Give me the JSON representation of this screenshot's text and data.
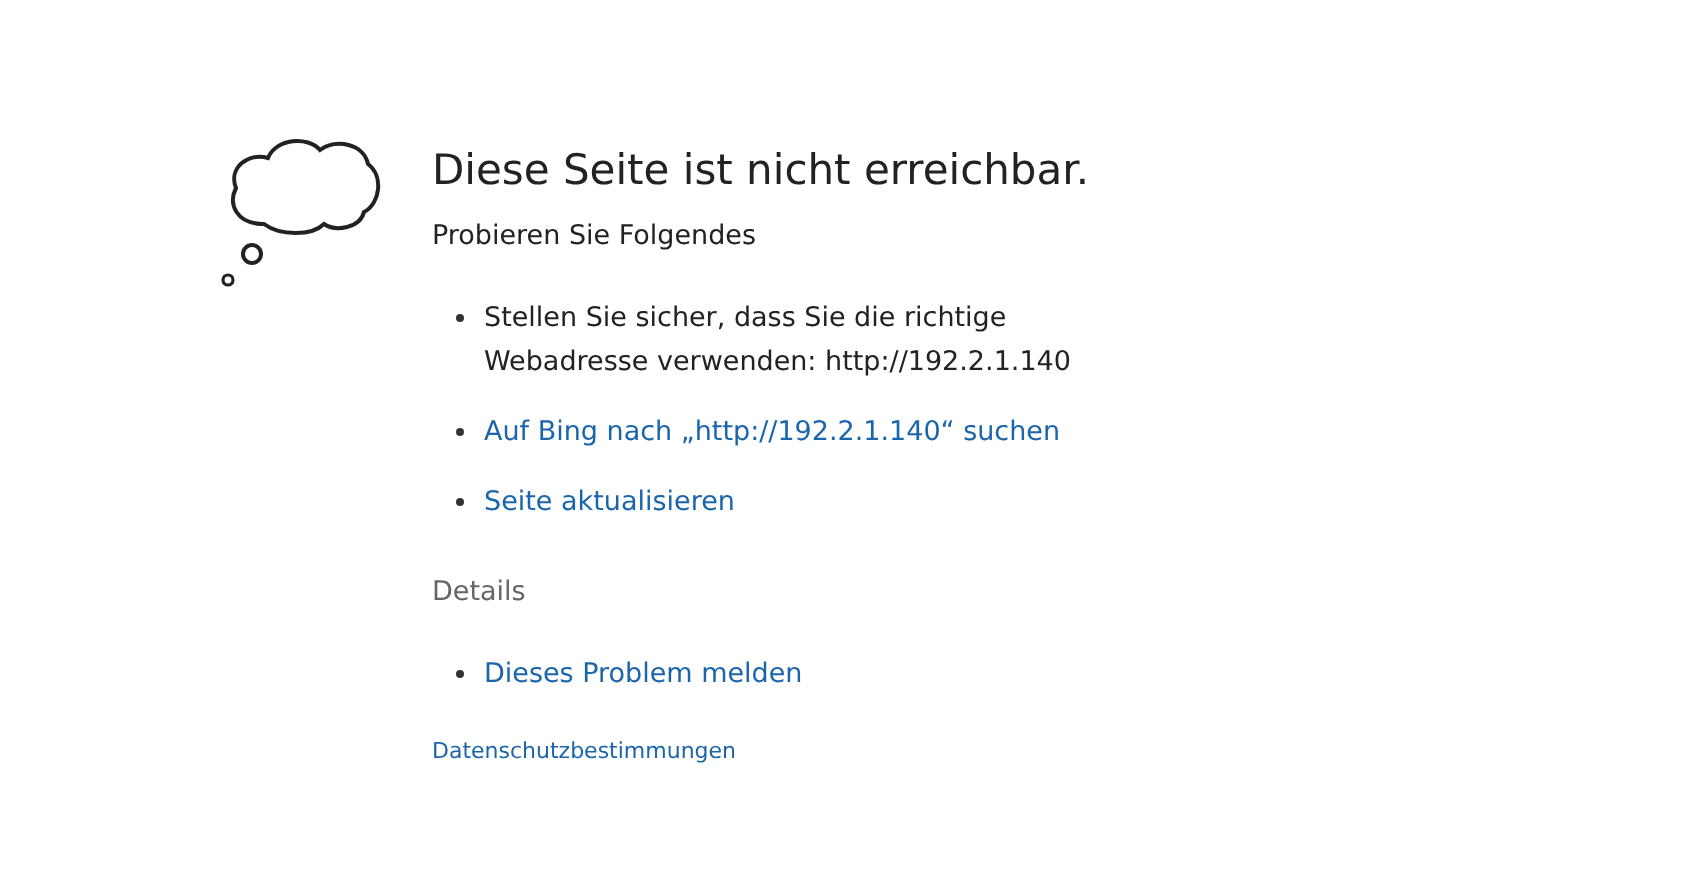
{
  "title": "Diese Seite ist nicht erreichbar.",
  "subtitle": "Probieren Sie Folgendes",
  "suggestions": [
    {
      "kind": "text",
      "text": "Stellen Sie sicher, dass Sie die richtige Webadresse verwenden: http://192.2.1.140"
    },
    {
      "kind": "link",
      "text": "Auf Bing nach „http://192.2.1.140“ suchen"
    },
    {
      "kind": "link",
      "text": "Seite aktualisieren"
    }
  ],
  "details": {
    "heading": "Details",
    "items": [
      {
        "kind": "link",
        "text": "Dieses Problem melden"
      }
    ]
  },
  "footer_link": "Datenschutzbestimmungen"
}
